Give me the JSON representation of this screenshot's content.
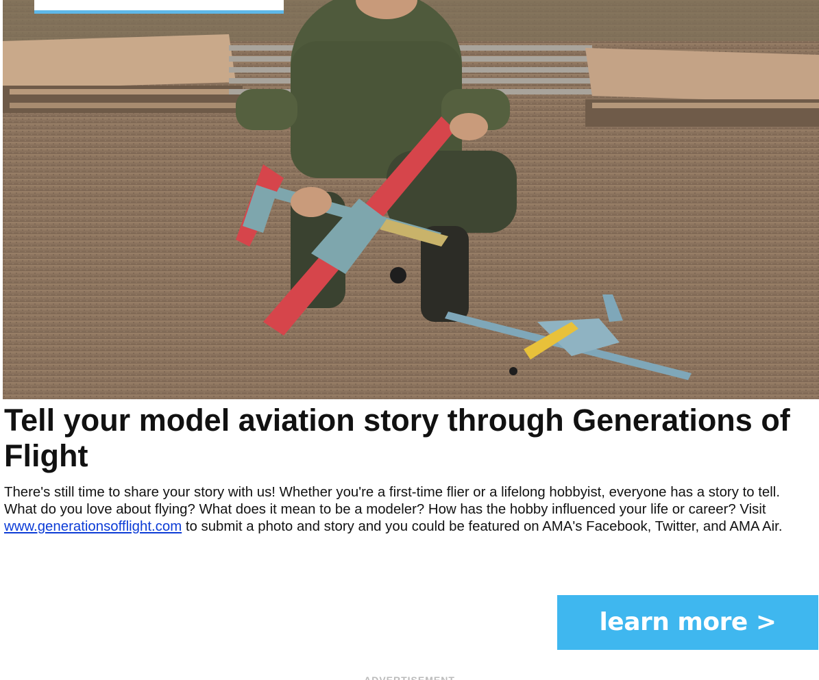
{
  "hero": {
    "image_description_icon": "photo-image",
    "accent_color": "#5fb8e8"
  },
  "article": {
    "headline": "Tell your model aviation story through Generations of Flight",
    "body_before_link": "There's still time to share your story with us! Whether you're a first-time flier or a lifelong hobbyist, everyone has a story to tell. What do you love about flying? What does it mean to be a modeler? How has the hobby influenced your life or career? Visit ",
    "link_text": "www.generationsofflight.com",
    "body_after_link": " to submit a photo and story and you could be featured on AMA's Facebook, Twitter, and AMA Air."
  },
  "cta": {
    "label": "learn more >",
    "color": "#3fb7ef"
  },
  "advertisement": {
    "label": "ADVERTISEMENT"
  }
}
